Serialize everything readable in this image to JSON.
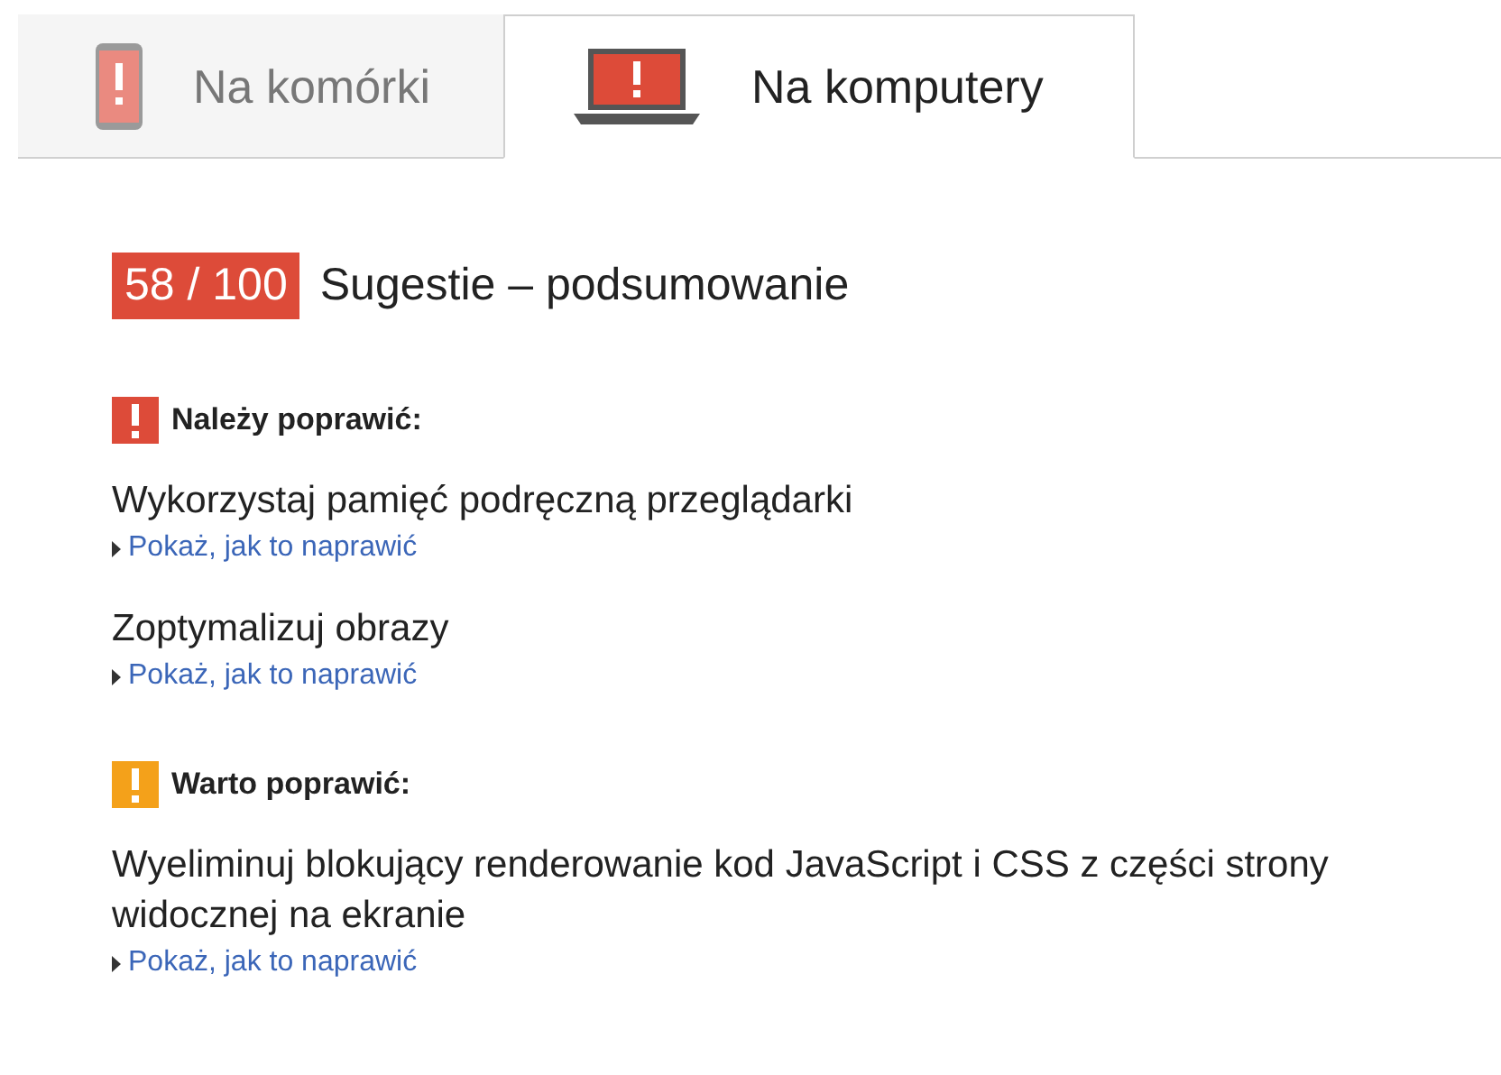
{
  "tabs": [
    {
      "label": "Na komórki",
      "kind": "mobile",
      "selected": false
    },
    {
      "label": "Na komputery",
      "kind": "desktop",
      "selected": true
    }
  ],
  "summary": {
    "score": "58 / 100",
    "title": "Sugestie – podsumowanie"
  },
  "sections": [
    {
      "kind": "must",
      "heading": "Należy poprawić:",
      "items": [
        {
          "text": "Wykorzystaj pamięć podręczną przeglądarki",
          "link": "Pokaż, jak to naprawić"
        },
        {
          "text": "Zoptymalizuj obrazy",
          "link": "Pokaż, jak to naprawić"
        }
      ]
    },
    {
      "kind": "consider",
      "heading": "Warto poprawić:",
      "items": [
        {
          "text": "Wyeliminuj blokujący renderowanie kod JavaScript i CSS z części strony widocznej na ekranie",
          "link": "Pokaż, jak to naprawić"
        }
      ]
    }
  ]
}
